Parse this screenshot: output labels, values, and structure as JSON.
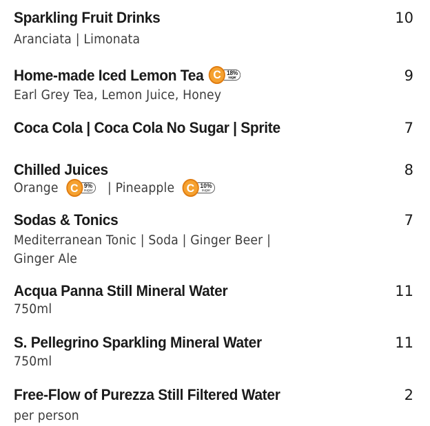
{
  "badges": {
    "icon": "c-circle-sugar-badge",
    "color": "#f5a130",
    "sugar_label": "sugar"
  },
  "items": [
    {
      "name": "Sparkling Fruit Drinks",
      "price": "10",
      "desc": "Aranciata | Limonata"
    },
    {
      "name": "Home-made Iced Lemon Tea",
      "price": "9",
      "desc": "Earl Grey Tea, Lemon Juice, Honey",
      "sugar": "18%"
    },
    {
      "name": "Coca Cola | Coca Cola No Sugar | Sprite",
      "price": "7"
    },
    {
      "name": "Chilled Juices",
      "price": "8",
      "desc_parts": [
        "Orange",
        "| Pineapple"
      ],
      "sugar_parts": [
        "9%",
        "10%"
      ]
    },
    {
      "name": "Sodas & Tonics",
      "price": "7",
      "desc_lines": [
        "Mediterranean Tonic | Soda | Ginger Beer |",
        "Ginger Ale"
      ]
    },
    {
      "name": "Acqua Panna Still Mineral Water",
      "price": "11",
      "desc": "750ml"
    },
    {
      "name": "S. Pellegrino Sparkling Mineral Water",
      "price": "11",
      "desc": "750ml"
    },
    {
      "name": "Free-Flow of Purezza Still Filtered Water",
      "price": "2",
      "desc": "per person"
    }
  ]
}
